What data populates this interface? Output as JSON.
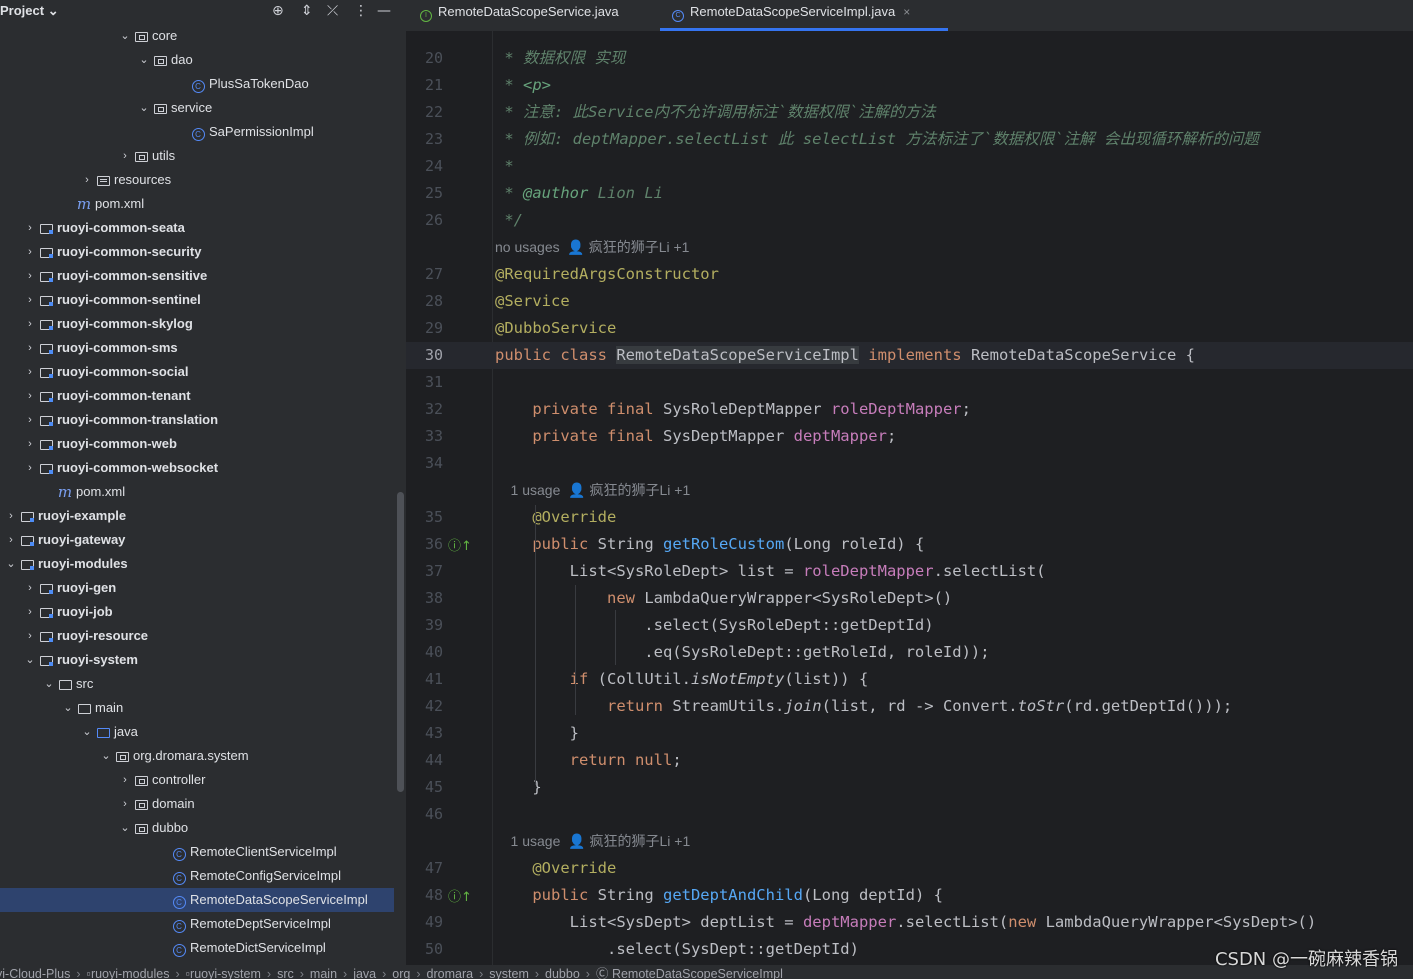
{
  "project_panel": {
    "title": "Project",
    "header_icons": [
      "target-icon",
      "expand-icon",
      "collapse-icon",
      "more-icon",
      "minimize-icon"
    ],
    "tree": [
      {
        "label": "core",
        "type": "package",
        "depth": 7,
        "expanded": true
      },
      {
        "label": "dao",
        "type": "package",
        "depth": 8,
        "expanded": true
      },
      {
        "label": "PlusSaTokenDao",
        "type": "class",
        "depth": 10
      },
      {
        "label": "service",
        "type": "package",
        "depth": 8,
        "expanded": true
      },
      {
        "label": "SaPermissionImpl",
        "type": "class",
        "depth": 10
      },
      {
        "label": "utils",
        "type": "package",
        "depth": 7,
        "expanded": false
      },
      {
        "label": "resources",
        "type": "resources",
        "depth": 5,
        "expanded": false
      },
      {
        "label": "pom.xml",
        "type": "maven",
        "depth": 4
      },
      {
        "label": "ruoyi-common-seata",
        "type": "module",
        "depth": 2,
        "expanded": false,
        "bold": true
      },
      {
        "label": "ruoyi-common-security",
        "type": "module",
        "depth": 2,
        "expanded": false,
        "bold": true
      },
      {
        "label": "ruoyi-common-sensitive",
        "type": "module",
        "depth": 2,
        "expanded": false,
        "bold": true
      },
      {
        "label": "ruoyi-common-sentinel",
        "type": "module",
        "depth": 2,
        "expanded": false,
        "bold": true
      },
      {
        "label": "ruoyi-common-skylog",
        "type": "module",
        "depth": 2,
        "expanded": false,
        "bold": true
      },
      {
        "label": "ruoyi-common-sms",
        "type": "module",
        "depth": 2,
        "expanded": false,
        "bold": true
      },
      {
        "label": "ruoyi-common-social",
        "type": "module",
        "depth": 2,
        "expanded": false,
        "bold": true
      },
      {
        "label": "ruoyi-common-tenant",
        "type": "module",
        "depth": 2,
        "expanded": false,
        "bold": true
      },
      {
        "label": "ruoyi-common-translation",
        "type": "module",
        "depth": 2,
        "expanded": false,
        "bold": true
      },
      {
        "label": "ruoyi-common-web",
        "type": "module",
        "depth": 2,
        "expanded": false,
        "bold": true
      },
      {
        "label": "ruoyi-common-websocket",
        "type": "module",
        "depth": 2,
        "expanded": false,
        "bold": true
      },
      {
        "label": "pom.xml",
        "type": "maven",
        "depth": 3
      },
      {
        "label": "ruoyi-example",
        "type": "module",
        "depth": 1,
        "expanded": false,
        "bold": true
      },
      {
        "label": "ruoyi-gateway",
        "type": "module",
        "depth": 1,
        "expanded": false,
        "bold": true
      },
      {
        "label": "ruoyi-modules",
        "type": "module",
        "depth": 1,
        "expanded": true,
        "bold": true
      },
      {
        "label": "ruoyi-gen",
        "type": "module",
        "depth": 2,
        "expanded": false,
        "bold": true
      },
      {
        "label": "ruoyi-job",
        "type": "module",
        "depth": 2,
        "expanded": false,
        "bold": true
      },
      {
        "label": "ruoyi-resource",
        "type": "module",
        "depth": 2,
        "expanded": false,
        "bold": true
      },
      {
        "label": "ruoyi-system",
        "type": "module",
        "depth": 2,
        "expanded": true,
        "bold": true
      },
      {
        "label": "src",
        "type": "folder",
        "depth": 3,
        "expanded": true
      },
      {
        "label": "main",
        "type": "folder",
        "depth": 4,
        "expanded": true
      },
      {
        "label": "java",
        "type": "java-folder",
        "depth": 5,
        "expanded": true
      },
      {
        "label": "org.dromara.system",
        "type": "package",
        "depth": 6,
        "expanded": true
      },
      {
        "label": "controller",
        "type": "package",
        "depth": 7,
        "expanded": false
      },
      {
        "label": "domain",
        "type": "package",
        "depth": 7,
        "expanded": false
      },
      {
        "label": "dubbo",
        "type": "package",
        "depth": 7,
        "expanded": true
      },
      {
        "label": "RemoteClientServiceImpl",
        "type": "class",
        "depth": 9
      },
      {
        "label": "RemoteConfigServiceImpl",
        "type": "class",
        "depth": 9
      },
      {
        "label": "RemoteDataScopeServiceImpl",
        "type": "class",
        "depth": 9,
        "selected": true
      },
      {
        "label": "RemoteDeptServiceImpl",
        "type": "class",
        "depth": 9
      },
      {
        "label": "RemoteDictServiceImpl",
        "type": "class",
        "depth": 9
      }
    ]
  },
  "tabs": [
    {
      "label": "RemoteDataScopeService.java",
      "icon": "interface-icon",
      "active": false
    },
    {
      "label": "RemoteDataScopeServiceImpl.java",
      "icon": "class-icon",
      "active": true,
      "close": "×"
    }
  ],
  "editor": {
    "current_line": 30,
    "lines": [
      {
        "n": "20",
        "tokens": [
          {
            "t": " * 数据权限 实现",
            "c": "c-doc"
          }
        ]
      },
      {
        "n": "21",
        "tokens": [
          {
            "t": " * ",
            "c": "c-doc"
          },
          {
            "t": "<p>",
            "c": "c-tag"
          }
        ]
      },
      {
        "n": "22",
        "tokens": [
          {
            "t": " * 注意: 此Service内不允许调用标注`数据权限`注解的方法",
            "c": "c-doc"
          }
        ]
      },
      {
        "n": "23",
        "tokens": [
          {
            "t": " * 例如: deptMapper.selectList 此 selectList 方法标注了`数据权限`注解 会出现循环解析的问题",
            "c": "c-doc"
          }
        ]
      },
      {
        "n": "24",
        "tokens": [
          {
            "t": " *",
            "c": "c-doc"
          }
        ]
      },
      {
        "n": "25",
        "tokens": [
          {
            "t": " * ",
            "c": "c-doc"
          },
          {
            "t": "@author",
            "c": "c-tag"
          },
          {
            "t": " Lion Li",
            "c": "c-doc"
          }
        ]
      },
      {
        "n": "26",
        "tokens": [
          {
            "t": " */",
            "c": "c-doc"
          }
        ]
      },
      {
        "inlay": "no usages  👤 疯狂的狮子Li +1"
      },
      {
        "n": "27",
        "tokens": [
          {
            "t": "@RequiredArgsConstructor",
            "c": "c-ann"
          }
        ]
      },
      {
        "n": "28",
        "tokens": [
          {
            "t": "@Service",
            "c": "c-ann"
          }
        ]
      },
      {
        "n": "29",
        "tokens": [
          {
            "t": "@DubboService",
            "c": "c-ann"
          }
        ]
      },
      {
        "n": "30",
        "tokens": [
          {
            "t": "public class ",
            "c": "c-kw"
          },
          {
            "t": "RemoteDataScopeServiceImpl",
            "c": "c-cls-hl"
          },
          {
            "t": " "
          },
          {
            "t": "implements",
            "c": "c-kw"
          },
          {
            "t": " RemoteDataScopeService {"
          }
        ]
      },
      {
        "n": "31",
        "tokens": []
      },
      {
        "n": "32",
        "tokens": [
          {
            "t": "    "
          },
          {
            "t": "private final ",
            "c": "c-kw"
          },
          {
            "t": "SysRoleDeptMapper "
          },
          {
            "t": "roleDeptMapper",
            "c": "c-fld"
          },
          {
            "t": ";"
          }
        ]
      },
      {
        "n": "33",
        "tokens": [
          {
            "t": "    "
          },
          {
            "t": "private final ",
            "c": "c-kw"
          },
          {
            "t": "SysDeptMapper "
          },
          {
            "t": "deptMapper",
            "c": "c-fld"
          },
          {
            "t": ";"
          }
        ]
      },
      {
        "n": "34",
        "tokens": []
      },
      {
        "inlay": "    1 usage  👤 疯狂的狮子Li +1"
      },
      {
        "n": "35",
        "tokens": [
          {
            "t": "    "
          },
          {
            "t": "@Override",
            "c": "c-ann"
          }
        ]
      },
      {
        "n": "36",
        "gicon": true,
        "tokens": [
          {
            "t": "    "
          },
          {
            "t": "public ",
            "c": "c-kw"
          },
          {
            "t": "String "
          },
          {
            "t": "getRoleCustom",
            "c": "c-fn"
          },
          {
            "t": "(Long roleId) {"
          }
        ]
      },
      {
        "n": "37",
        "tokens": [
          {
            "t": "        List<SysRoleDept> list = "
          },
          {
            "t": "roleDeptMapper",
            "c": "c-fld"
          },
          {
            "t": ".selectList("
          }
        ]
      },
      {
        "n": "38",
        "tokens": [
          {
            "t": "            "
          },
          {
            "t": "new ",
            "c": "c-kw"
          },
          {
            "t": "LambdaQueryWrapper<SysRoleDept>()"
          }
        ]
      },
      {
        "n": "39",
        "tokens": [
          {
            "t": "                .select(SysRoleDept::getDeptId)"
          }
        ]
      },
      {
        "n": "40",
        "tokens": [
          {
            "t": "                .eq(SysRoleDept::getRoleId, roleId));"
          }
        ]
      },
      {
        "n": "41",
        "tokens": [
          {
            "t": "        "
          },
          {
            "t": "if ",
            "c": "c-kw"
          },
          {
            "t": "(CollUtil."
          },
          {
            "t": "isNotEmpty",
            "c": "c-st"
          },
          {
            "t": "(list)) {"
          }
        ]
      },
      {
        "n": "42",
        "tokens": [
          {
            "t": "            "
          },
          {
            "t": "return ",
            "c": "c-kw"
          },
          {
            "t": "StreamUtils."
          },
          {
            "t": "join",
            "c": "c-st"
          },
          {
            "t": "(list, rd -> Convert."
          },
          {
            "t": "toStr",
            "c": "c-st"
          },
          {
            "t": "(rd.getDeptId()));"
          }
        ]
      },
      {
        "n": "43",
        "tokens": [
          {
            "t": "        }"
          }
        ]
      },
      {
        "n": "44",
        "tokens": [
          {
            "t": "        "
          },
          {
            "t": "return null",
            "c": "c-kw"
          },
          {
            "t": ";"
          }
        ]
      },
      {
        "n": "45",
        "tokens": [
          {
            "t": "    }"
          }
        ]
      },
      {
        "n": "46",
        "tokens": []
      },
      {
        "inlay": "    1 usage  👤 疯狂的狮子Li +1"
      },
      {
        "n": "47",
        "tokens": [
          {
            "t": "    "
          },
          {
            "t": "@Override",
            "c": "c-ann"
          }
        ]
      },
      {
        "n": "48",
        "gicon": true,
        "tokens": [
          {
            "t": "    "
          },
          {
            "t": "public ",
            "c": "c-kw"
          },
          {
            "t": "String "
          },
          {
            "t": "getDeptAndChild",
            "c": "c-fn"
          },
          {
            "t": "(Long deptId) {"
          }
        ]
      },
      {
        "n": "49",
        "tokens": [
          {
            "t": "        List<SysDept> deptList = "
          },
          {
            "t": "deptMapper",
            "c": "c-fld"
          },
          {
            "t": ".selectList("
          },
          {
            "t": "new ",
            "c": "c-kw"
          },
          {
            "t": "LambdaQueryWrapper<SysDept>()"
          }
        ]
      },
      {
        "n": "50",
        "tokens": [
          {
            "t": "            .select(SysDept::getDeptId)"
          }
        ]
      }
    ]
  },
  "status_bar": {
    "breadcrumbs": [
      "yi-Cloud-Plus",
      "ruoyi-modules",
      "ruoyi-system",
      "src",
      "main",
      "java",
      "org",
      "dromara",
      "system",
      "dubbo",
      "RemoteDataScopeServiceImpl"
    ]
  },
  "watermark": "CSDN @一碗麻辣香锅"
}
